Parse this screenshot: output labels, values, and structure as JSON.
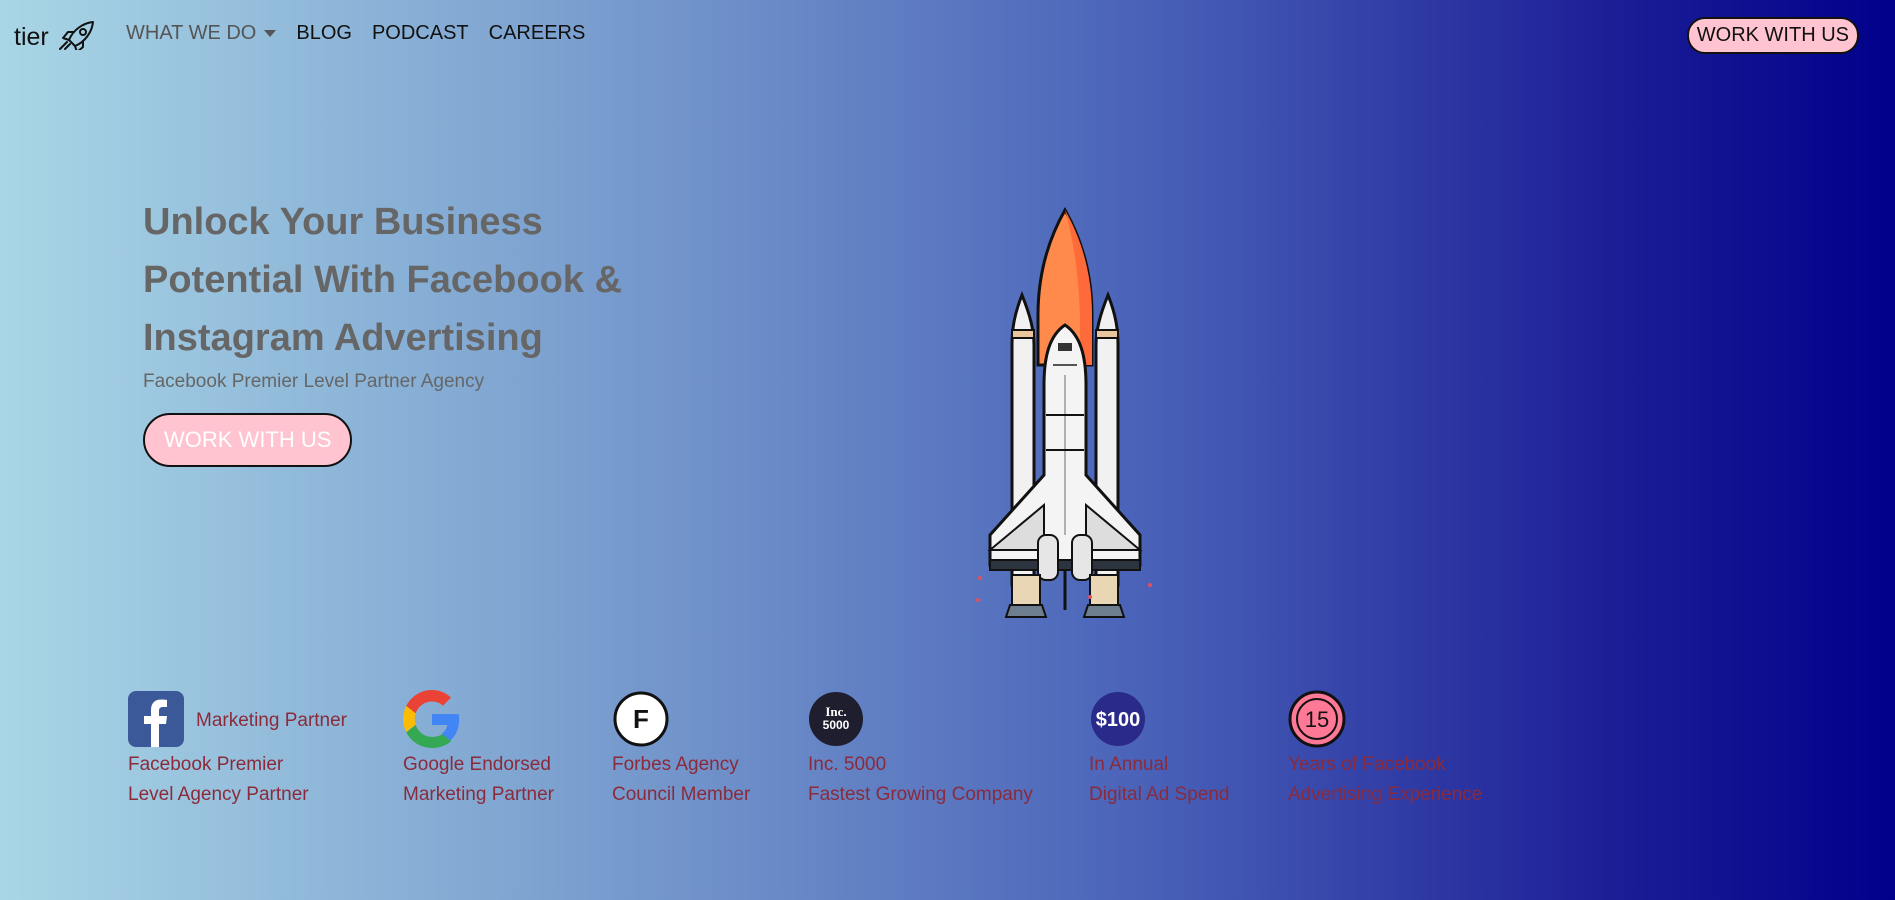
{
  "nav": {
    "brand": "tier",
    "links": [
      {
        "label": "WHAT WE DO"
      },
      {
        "label": "BLOG"
      },
      {
        "label": "PODCAST"
      },
      {
        "label": "CAREERS"
      }
    ],
    "cta": "WORK WITH US"
  },
  "hero": {
    "title_lines": [
      "Unlock Your Business",
      "Potential With Facebook &",
      "Instagram Advertising"
    ],
    "subtitle": "Facebook Premier Level Partner Agency",
    "cta": "WORK WITH US"
  },
  "badges": [
    {
      "icon": "facebook-icon",
      "heading": "Marketing Partner",
      "lines": [
        "Facebook Premier",
        "Level Agency Partner"
      ]
    },
    {
      "icon": "google-icon",
      "lines": [
        "Google Endorsed",
        "Marketing Partner"
      ]
    },
    {
      "icon": "forbes-icon",
      "icon_text": "F",
      "lines": [
        "Forbes Agency",
        "Council Member"
      ]
    },
    {
      "icon": "inc5000-icon",
      "icon_text": "Inc. 5000",
      "lines": [
        "Inc. 5000",
        "Fastest Growing Company"
      ]
    },
    {
      "icon": "dollar-badge-icon",
      "icon_text": "$100",
      "lines": [
        "In Annual",
        "Digital Ad Spend"
      ]
    },
    {
      "icon": "fifteen-badge-icon",
      "icon_text": "15",
      "lines": [
        "Years of Facebook",
        "Advertising Experience"
      ]
    }
  ],
  "colors": {
    "cta_bg": "#ffc4d0",
    "badge_text": "#8b2a3a",
    "heading_text": "#666666"
  }
}
